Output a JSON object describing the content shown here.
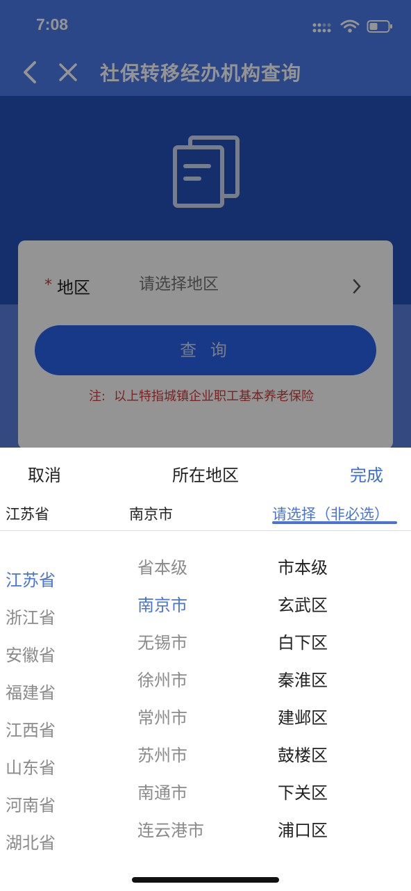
{
  "status_bar": {
    "time": "7:08"
  },
  "nav": {
    "title": "社保转移经办机构查询"
  },
  "form": {
    "required_mark": "*",
    "region_label": "地区",
    "region_placeholder": "请选择地区",
    "query_button": "查 询",
    "note_prefix": "注:",
    "note_text": "以上特指城镇企业职工基本养老保险"
  },
  "picker": {
    "cancel": "取消",
    "title": "所在地区",
    "done": "完成",
    "tabs": [
      "江苏省",
      "南京市",
      "请选择（非必选）"
    ],
    "active_tab": 2,
    "provinces": [
      "江苏省",
      "浙江省",
      "安徽省",
      "福建省",
      "江西省",
      "山东省",
      "河南省",
      "湖北省"
    ],
    "selected_province": "江苏省",
    "cities": [
      "省本级",
      "南京市",
      "无锡市",
      "徐州市",
      "常州市",
      "苏州市",
      "南通市",
      "连云港市"
    ],
    "selected_city": "南京市",
    "districts": [
      "市本级",
      "玄武区",
      "白下区",
      "秦淮区",
      "建邺区",
      "鼓楼区",
      "下关区",
      "浦口区"
    ]
  },
  "colors": {
    "nav_blue": "#4a7ae8",
    "accent": "#4a74d4",
    "hero_blue": "#2451b8",
    "note_red": "#d23b3b"
  }
}
